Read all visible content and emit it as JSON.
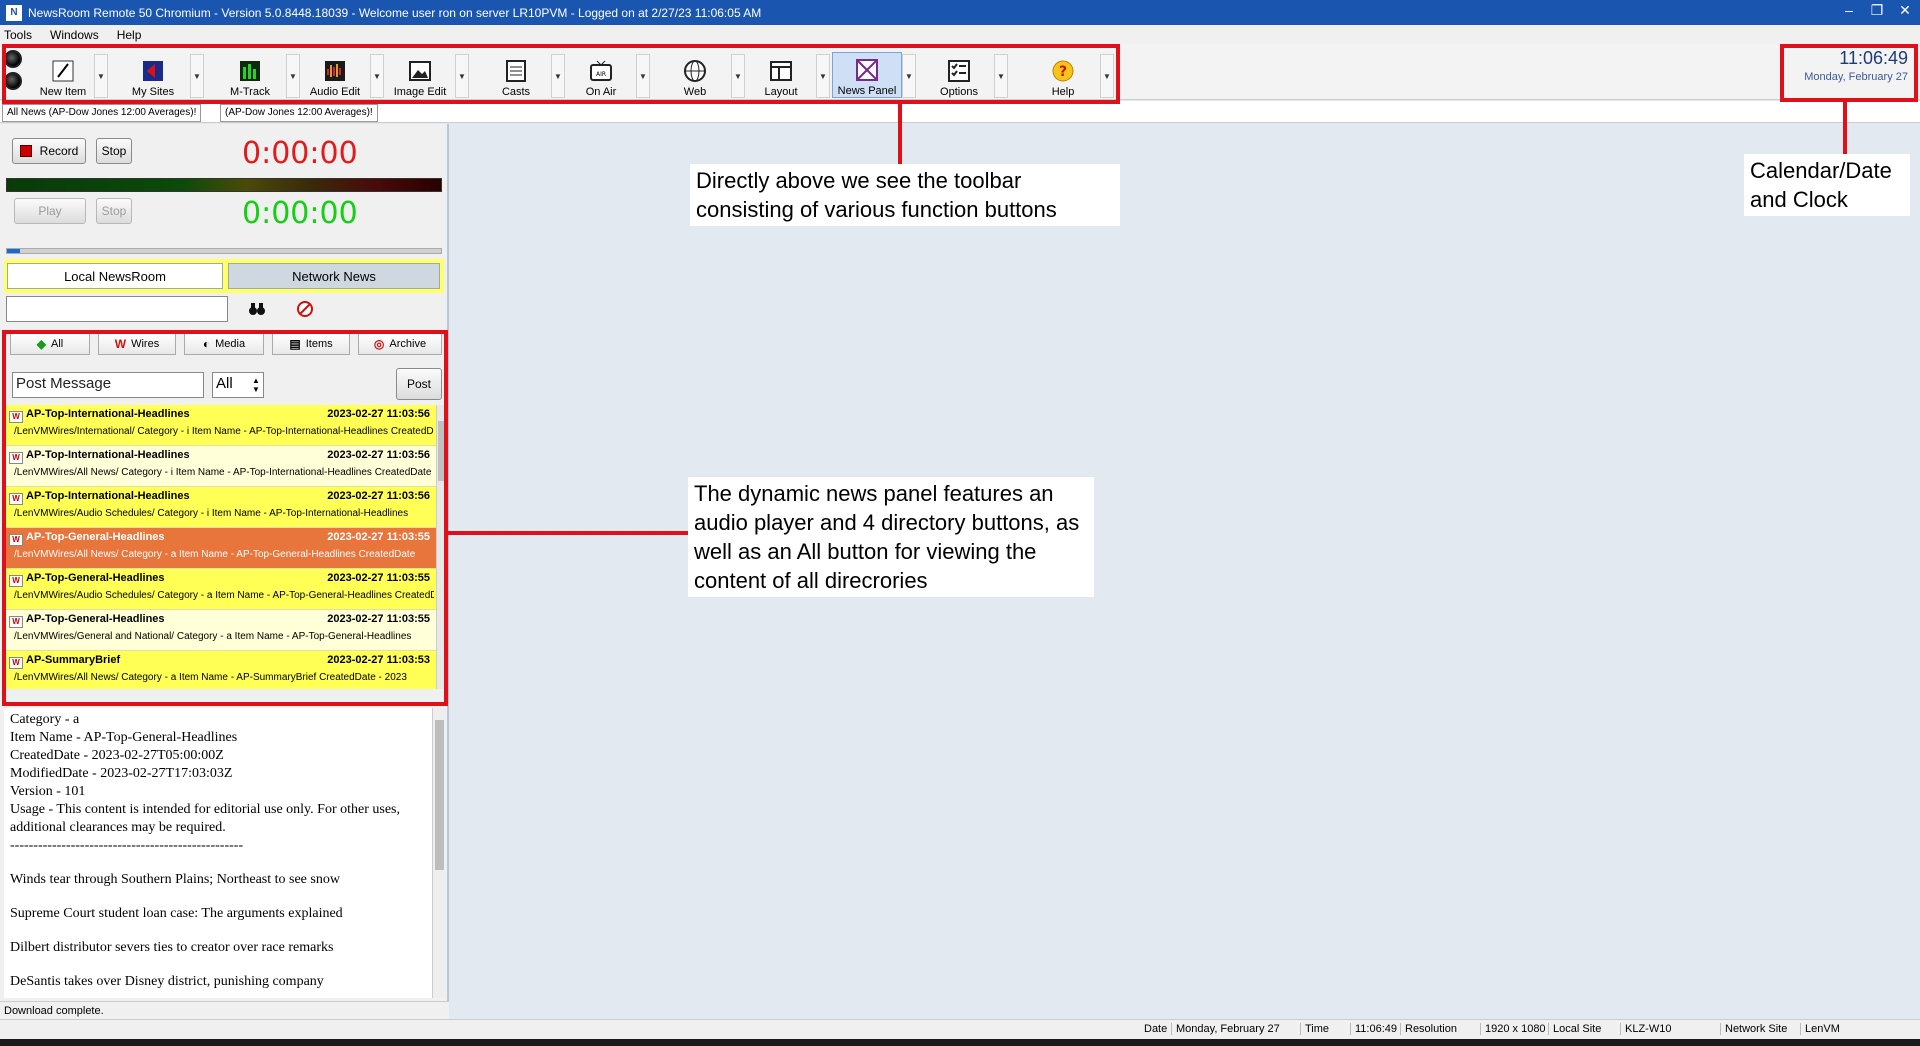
{
  "window": {
    "title": "NewsRoom Remote 50 Chromium - Version 5.0.8448.18039 - Welcome user ron on server LR10PVM - Logged on at 2/27/23 11:06:05 AM"
  },
  "menu": [
    "Tools",
    "Windows",
    "Help"
  ],
  "toolbar": {
    "buttons": [
      {
        "label": "New Item",
        "icon": "pencil-icon"
      },
      {
        "label": "My Sites",
        "icon": "sites-icon"
      },
      {
        "label": "M-Track",
        "icon": "mtrack-icon"
      },
      {
        "label": "Audio Edit",
        "icon": "audio-edit-icon"
      },
      {
        "label": "Image Edit",
        "icon": "image-icon"
      },
      {
        "label": "Casts",
        "icon": "casts-icon"
      },
      {
        "label": "On Air",
        "icon": "on-air-icon"
      },
      {
        "label": "Web",
        "icon": "globe-icon"
      },
      {
        "label": "Layout",
        "icon": "layout-icon"
      },
      {
        "label": "News Panel",
        "icon": "news-panel-icon"
      },
      {
        "label": "Options",
        "icon": "checklist-icon"
      },
      {
        "label": "Help",
        "icon": "help-icon"
      }
    ],
    "active": "News Panel"
  },
  "clock": {
    "time": "11:06:49",
    "date": "Monday, February 27"
  },
  "tabs": [
    "All News (AP-Dow Jones 12:00 Averages)!",
    "(AP-Dow Jones 12:00 Averages)!"
  ],
  "recorder": {
    "record_label": "Record",
    "stop_label": "Stop",
    "time": "0:00:00"
  },
  "player": {
    "play_label": "Play",
    "stop_label": "Stop",
    "time": "0:00:00",
    "progress": 0.03
  },
  "scope": {
    "local": "Local NewsRoom",
    "network": "Network News"
  },
  "filters": [
    {
      "label": "All",
      "icon": "all-icon"
    },
    {
      "label": "Wires",
      "icon": "wires-icon"
    },
    {
      "label": "Media",
      "icon": "media-icon"
    },
    {
      "label": "Items",
      "icon": "items-icon"
    },
    {
      "label": "Archive",
      "icon": "archive-icon"
    }
  ],
  "post": {
    "placeholder": "Post Message",
    "select_value": "All",
    "button": "Post"
  },
  "news_items": [
    {
      "title": "AP-Top-International-Headlines",
      "date": "2023-02-27 11:03:56",
      "path": "/LenVMWires/International/ Category - i Item Name - AP-Top-International-Headlines CreatedDate",
      "style": "yellow"
    },
    {
      "title": "AP-Top-International-Headlines",
      "date": "2023-02-27 11:03:56",
      "path": "/LenVMWires/All News/ Category - i Item Name - AP-Top-International-Headlines CreatedDate",
      "style": "pale"
    },
    {
      "title": "AP-Top-International-Headlines",
      "date": "2023-02-27 11:03:56",
      "path": "/LenVMWires/Audio Schedules/ Category - i Item Name - AP-Top-International-Headlines",
      "style": "yellow"
    },
    {
      "title": "AP-Top-General-Headlines",
      "date": "2023-02-27 11:03:55",
      "path": "/LenVMWires/All News/ Category - a Item Name - AP-Top-General-Headlines CreatedDate",
      "style": "selected"
    },
    {
      "title": "AP-Top-General-Headlines",
      "date": "2023-02-27 11:03:55",
      "path": "/LenVMWires/Audio Schedules/ Category - a Item Name - AP-Top-General-Headlines CreatedDate",
      "style": "yellow"
    },
    {
      "title": "AP-Top-General-Headlines",
      "date": "2023-02-27 11:03:55",
      "path": "/LenVMWires/General and National/ Category - a Item Name - AP-Top-General-Headlines",
      "style": "pale"
    },
    {
      "title": "AP-SummaryBrief",
      "date": "2023-02-27 11:03:53",
      "path": "/LenVMWires/All News/ Category - a Item Name - AP-SummaryBrief CreatedDate - 2023",
      "style": "yellow"
    }
  ],
  "detail": {
    "lines": [
      "Category - a",
      "Item Name - AP-Top-General-Headlines",
      "CreatedDate - 2023-02-27T05:00:00Z",
      "ModifiedDate - 2023-02-27T17:03:03Z",
      "Version - 101",
      "Usage - This content is intended for editorial use only. For other uses, additional clearances may be required.",
      "--------------------------------------------------"
    ],
    "headlines": [
      "Winds tear through Southern Plains; Northeast to see snow",
      "Supreme Court student loan case: The arguments explained",
      "Dilbert distributor severs ties to creator over race remarks",
      "DeSantis takes over Disney district, punishing company"
    ]
  },
  "download_status": "Download complete.",
  "annotations": {
    "toolbar": "Directly above we see the toolbar consisting of various function buttons",
    "clock": "Calendar/Date and Clock",
    "panel": "The dynamic news panel features an audio player and 4 directory buttons, as well as an All button for viewing the content of all direcrories"
  },
  "statusbar": {
    "date_label": "Date",
    "date_value": "Monday, February 27",
    "time_label": "Time",
    "time_value": "11:06:49",
    "resolution_label": "Resolution",
    "resolution_value": "1920 x 1080",
    "local_site_label": "Local Site",
    "local_site_value": "KLZ-W10",
    "network_site_label": "Network Site",
    "network_site_value": "LenVM"
  }
}
